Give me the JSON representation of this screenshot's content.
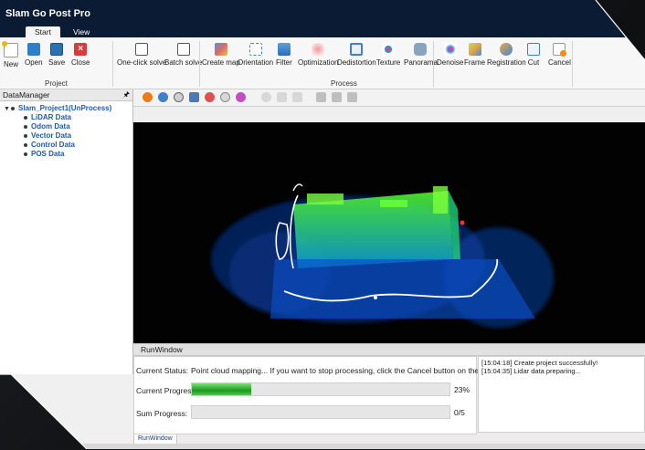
{
  "app": {
    "title": "Slam Go Post Pro"
  },
  "tabs": [
    {
      "label": "Start"
    },
    {
      "label": "View"
    }
  ],
  "ribbon": {
    "project_group": "Project",
    "process_group": "Process",
    "project_buttons": [
      "New",
      "Open",
      "Save",
      "Close"
    ],
    "process_buttons": [
      "One-click solve",
      "Batch solve",
      "Create map",
      "Orientation",
      "Filter",
      "Optimization",
      "Dedistortion",
      "Texture",
      "Panorama",
      "Denoise",
      "Frame",
      "Registration",
      "Cut",
      "Cancel"
    ]
  },
  "data_manager": {
    "title": "DataManager",
    "project": "Slam_Project1(UnProcess)",
    "children": [
      "LiDAR Data",
      "Odom Data",
      "Vector Data",
      "Control Data",
      "POS Data"
    ]
  },
  "run_window": {
    "title": "RunWindow",
    "current_status_label": "Current Status:",
    "current_status": "Point cloud mapping...   If you want to stop processing, click the Cancel button on the toolbar!",
    "current_progress_label": "Current Progress:",
    "current_progress": 0.23,
    "current_progress_text": "23%",
    "sum_progress_label": "Sum Progress:",
    "sum_progress": 0,
    "sum_progress_text": "0/5",
    "log": [
      "[15:04:18] Create project successfully!",
      "[15:04:35] Lidar data preparing..."
    ],
    "bottom_tab": "RunWindow"
  },
  "colors": {
    "titlebar": "#0b1b33",
    "accent_green": "#1c9b1c",
    "tree_text": "#1f5aa6"
  }
}
